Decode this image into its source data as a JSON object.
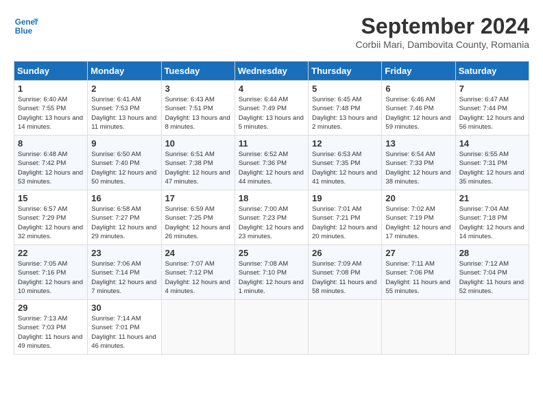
{
  "header": {
    "logo_line1": "General",
    "logo_line2": "Blue",
    "month": "September 2024",
    "location": "Corbii Mari, Dambovita County, Romania"
  },
  "columns": [
    "Sunday",
    "Monday",
    "Tuesday",
    "Wednesday",
    "Thursday",
    "Friday",
    "Saturday"
  ],
  "weeks": [
    [
      {
        "day": "1",
        "sunrise": "6:40 AM",
        "sunset": "7:55 PM",
        "daylight": "13 hours and 14 minutes."
      },
      {
        "day": "2",
        "sunrise": "6:41 AM",
        "sunset": "7:53 PM",
        "daylight": "13 hours and 11 minutes."
      },
      {
        "day": "3",
        "sunrise": "6:43 AM",
        "sunset": "7:51 PM",
        "daylight": "13 hours and 8 minutes."
      },
      {
        "day": "4",
        "sunrise": "6:44 AM",
        "sunset": "7:49 PM",
        "daylight": "13 hours and 5 minutes."
      },
      {
        "day": "5",
        "sunrise": "6:45 AM",
        "sunset": "7:48 PM",
        "daylight": "13 hours and 2 minutes."
      },
      {
        "day": "6",
        "sunrise": "6:46 AM",
        "sunset": "7:46 PM",
        "daylight": "12 hours and 59 minutes."
      },
      {
        "day": "7",
        "sunrise": "6:47 AM",
        "sunset": "7:44 PM",
        "daylight": "12 hours and 56 minutes."
      }
    ],
    [
      {
        "day": "8",
        "sunrise": "6:48 AM",
        "sunset": "7:42 PM",
        "daylight": "12 hours and 53 minutes."
      },
      {
        "day": "9",
        "sunrise": "6:50 AM",
        "sunset": "7:40 PM",
        "daylight": "12 hours and 50 minutes."
      },
      {
        "day": "10",
        "sunrise": "6:51 AM",
        "sunset": "7:38 PM",
        "daylight": "12 hours and 47 minutes."
      },
      {
        "day": "11",
        "sunrise": "6:52 AM",
        "sunset": "7:36 PM",
        "daylight": "12 hours and 44 minutes."
      },
      {
        "day": "12",
        "sunrise": "6:53 AM",
        "sunset": "7:35 PM",
        "daylight": "12 hours and 41 minutes."
      },
      {
        "day": "13",
        "sunrise": "6:54 AM",
        "sunset": "7:33 PM",
        "daylight": "12 hours and 38 minutes."
      },
      {
        "day": "14",
        "sunrise": "6:55 AM",
        "sunset": "7:31 PM",
        "daylight": "12 hours and 35 minutes."
      }
    ],
    [
      {
        "day": "15",
        "sunrise": "6:57 AM",
        "sunset": "7:29 PM",
        "daylight": "12 hours and 32 minutes."
      },
      {
        "day": "16",
        "sunrise": "6:58 AM",
        "sunset": "7:27 PM",
        "daylight": "12 hours and 29 minutes."
      },
      {
        "day": "17",
        "sunrise": "6:59 AM",
        "sunset": "7:25 PM",
        "daylight": "12 hours and 26 minutes."
      },
      {
        "day": "18",
        "sunrise": "7:00 AM",
        "sunset": "7:23 PM",
        "daylight": "12 hours and 23 minutes."
      },
      {
        "day": "19",
        "sunrise": "7:01 AM",
        "sunset": "7:21 PM",
        "daylight": "12 hours and 20 minutes."
      },
      {
        "day": "20",
        "sunrise": "7:02 AM",
        "sunset": "7:19 PM",
        "daylight": "12 hours and 17 minutes."
      },
      {
        "day": "21",
        "sunrise": "7:04 AM",
        "sunset": "7:18 PM",
        "daylight": "12 hours and 14 minutes."
      }
    ],
    [
      {
        "day": "22",
        "sunrise": "7:05 AM",
        "sunset": "7:16 PM",
        "daylight": "12 hours and 10 minutes."
      },
      {
        "day": "23",
        "sunrise": "7:06 AM",
        "sunset": "7:14 PM",
        "daylight": "12 hours and 7 minutes."
      },
      {
        "day": "24",
        "sunrise": "7:07 AM",
        "sunset": "7:12 PM",
        "daylight": "12 hours and 4 minutes."
      },
      {
        "day": "25",
        "sunrise": "7:08 AM",
        "sunset": "7:10 PM",
        "daylight": "12 hours and 1 minute."
      },
      {
        "day": "26",
        "sunrise": "7:09 AM",
        "sunset": "7:08 PM",
        "daylight": "11 hours and 58 minutes."
      },
      {
        "day": "27",
        "sunrise": "7:11 AM",
        "sunset": "7:06 PM",
        "daylight": "11 hours and 55 minutes."
      },
      {
        "day": "28",
        "sunrise": "7:12 AM",
        "sunset": "7:04 PM",
        "daylight": "11 hours and 52 minutes."
      }
    ],
    [
      {
        "day": "29",
        "sunrise": "7:13 AM",
        "sunset": "7:03 PM",
        "daylight": "11 hours and 49 minutes."
      },
      {
        "day": "30",
        "sunrise": "7:14 AM",
        "sunset": "7:01 PM",
        "daylight": "11 hours and 46 minutes."
      },
      null,
      null,
      null,
      null,
      null
    ]
  ]
}
